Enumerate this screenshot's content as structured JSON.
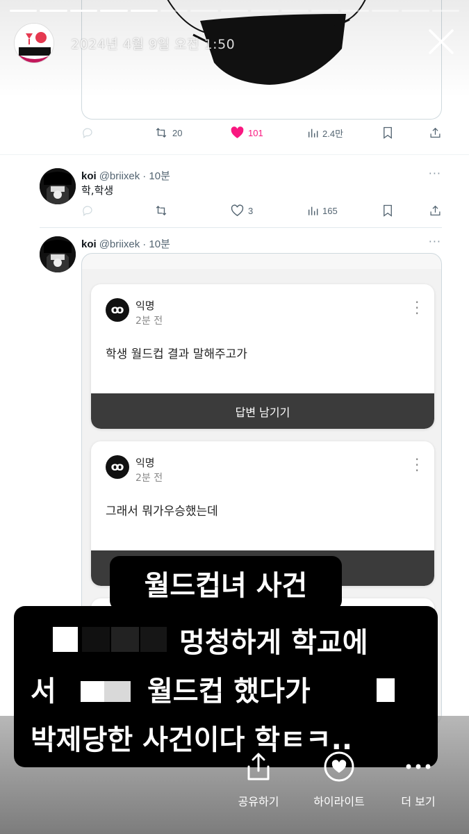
{
  "story": {
    "date": "2024년 4월 9일 오전 1:50",
    "progress_total": 15,
    "progress_done": 5
  },
  "tweet1": {
    "reply_count": "",
    "retweets": "20",
    "likes": "101",
    "views": "2.4만",
    "liked": true
  },
  "tweet2": {
    "name": "koi",
    "handle": "@briixek",
    "time": "· 10분",
    "text": "학,학생",
    "retweets": "",
    "likes": "3",
    "views": "165"
  },
  "tweet3": {
    "name": "koi",
    "handle": "@briixek",
    "time": "· 10분"
  },
  "embedded_cards": [
    {
      "author": "익명",
      "time": "2분 전",
      "text": "학생 월드컵 결과 말해주고가",
      "button": "답변 남기기"
    },
    {
      "author": "익명",
      "time": "2분 전",
      "text": "그래서 뭐가우승했는데",
      "button": ""
    }
  ],
  "caption": {
    "title": "월드컵녀 사건",
    "line1": "멍청하게 학교에",
    "line2_start": "서",
    "line2_end": "월드컵 했다가",
    "line3": "박제당한 사건이다 학ㅌㅋ.."
  },
  "bottom_bar": {
    "share": "공유하기",
    "highlight": "하이라이트",
    "more": "더 보기"
  },
  "colors": {
    "like_pink": "#f91880",
    "text_secondary": "#536471",
    "border": "#cfd9de"
  }
}
